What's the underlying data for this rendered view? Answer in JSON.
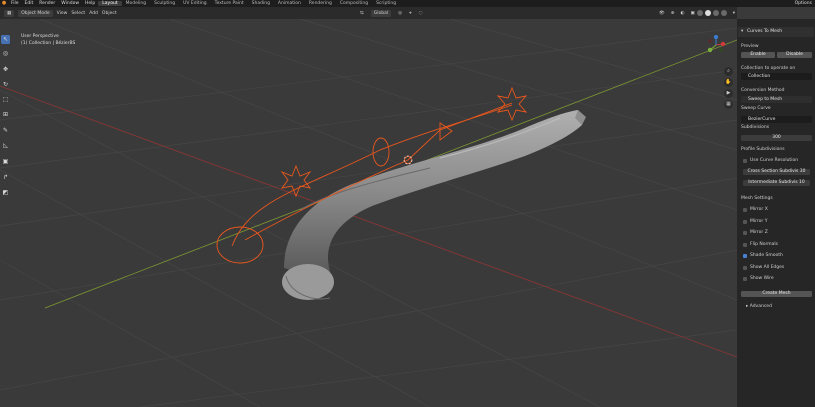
{
  "top_menu": [
    "File",
    "Edit",
    "Render",
    "Window",
    "Help"
  ],
  "workspaces": [
    "Layout",
    "Modeling",
    "Sculpting",
    "UV Editing",
    "Texture Paint",
    "Shading",
    "Animation",
    "Rendering",
    "Compositing",
    "Scripting"
  ],
  "top_right": "Options",
  "header": {
    "mode": "Object Mode",
    "menus": [
      "View",
      "Select",
      "Add",
      "Object"
    ],
    "orientation": "Global"
  },
  "viewport": {
    "view_name": "User Perspective",
    "collection_info": "(1) Collection | BézierBS"
  },
  "panel": {
    "title": "Curves To Mesh",
    "preview_label": "Preview",
    "enable": "Enable",
    "disable": "Disable",
    "collection_label": "Collection to operate on",
    "collection_value": "Collection",
    "conversion_label": "Conversion Method",
    "conversion_value": "Sweep to Mesh",
    "sweep_label": "Sweep Curve",
    "sweep_value": "BezierCurve",
    "subdivisions_label": "Subdivisions",
    "subdivisions_value": "300",
    "profile_label": "Profile Subdivisions",
    "use_curve_resolution": "Use Curve Resolution",
    "cross_section": "Cross Section Subdivis",
    "cross_section_value": "30",
    "intermediate": "Intermediate Subdivis",
    "intermediate_value": "10",
    "mesh_settings": "Mesh Settings",
    "options": [
      {
        "label": "Mirror X",
        "checked": false
      },
      {
        "label": "Mirror Y",
        "checked": false
      },
      {
        "label": "Mirror Z",
        "checked": false
      },
      {
        "label": "Flip Normals",
        "checked": false
      },
      {
        "label": "Shade Smooth",
        "checked": true
      },
      {
        "label": "Show All Edges",
        "checked": false
      },
      {
        "label": "Show Wire",
        "checked": false
      }
    ],
    "create_mesh": "Create Mesh",
    "advanced": "Advanced"
  },
  "colors": {
    "accent": "#4672b4",
    "selection": "#e8571d",
    "x_axis": "#a33a3a",
    "y_axis": "#8aa83a"
  }
}
